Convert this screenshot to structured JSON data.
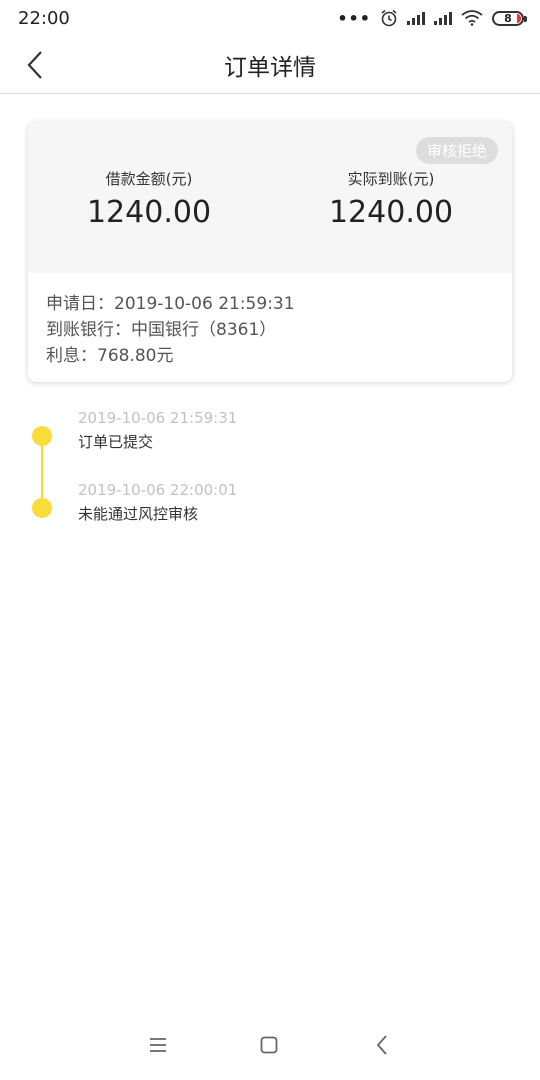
{
  "status_bar": {
    "time": "22:00",
    "dots": "•••",
    "battery": "8"
  },
  "nav": {
    "title": "订单详情"
  },
  "card": {
    "badge": "审核拒绝",
    "loan_amount_label": "借款金额(元)",
    "loan_amount": "1240.00",
    "actual_amount_label": "实际到账(元)",
    "actual_amount": "1240.00",
    "apply_date": "申请日：2019-10-06 21:59:31",
    "bank": "到账银行：中国银行（8361）",
    "interest": "利息：768.80元"
  },
  "timeline": [
    {
      "time": "2019-10-06 21:59:31",
      "text": "订单已提交"
    },
    {
      "time": "2019-10-06 22:00:01",
      "text": "未能通过风控审核"
    }
  ],
  "colors": {
    "accent": "#f9dd3a",
    "badge_bg": "#dddddd",
    "card_top_bg": "#f6f6f6"
  }
}
